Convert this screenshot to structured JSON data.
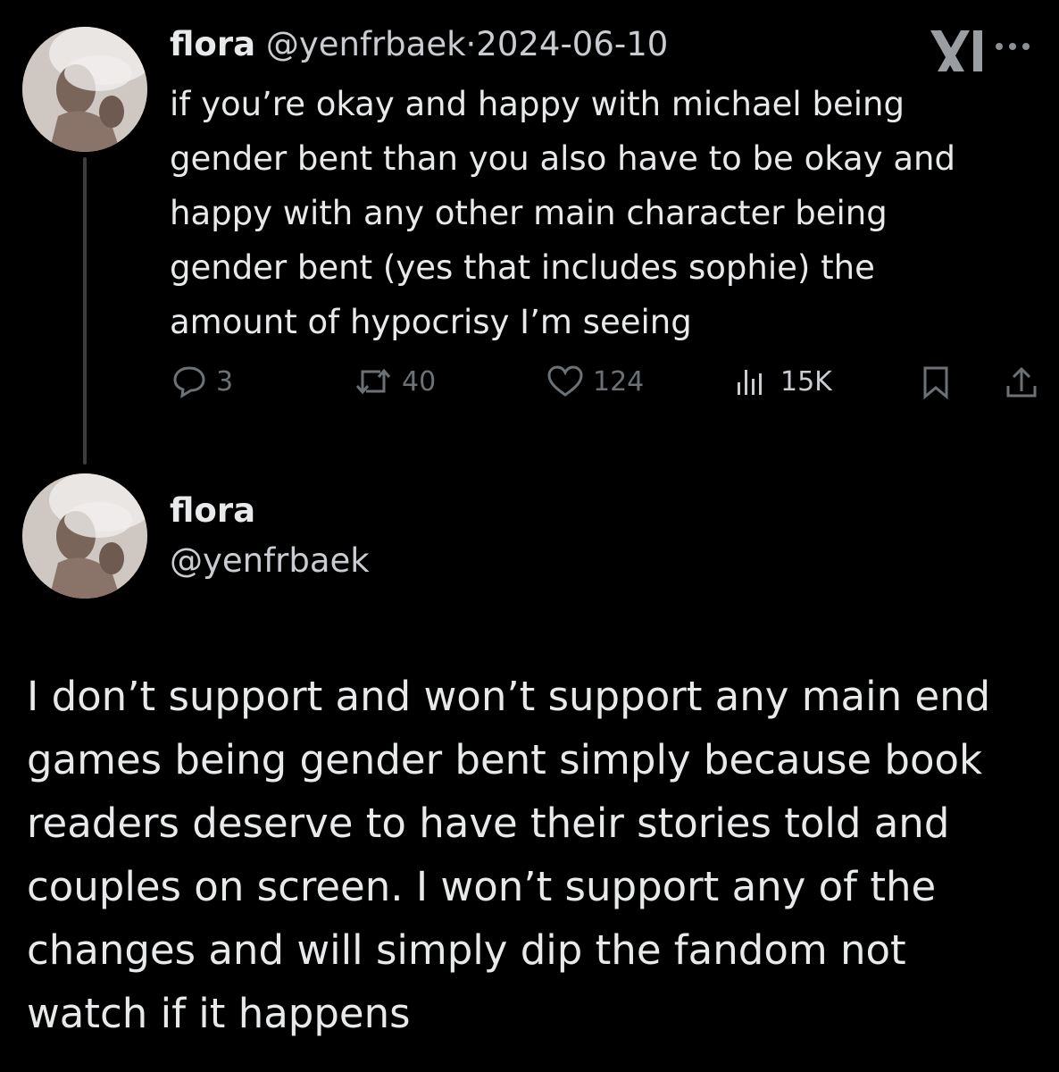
{
  "tweet1": {
    "display_name": "flora",
    "handle": "@yenfrbaek",
    "separator": "·",
    "date": "2024-06-10",
    "text": "if you’re okay and happy with michael being\ngender bent than you also have to be okay and\nhappy with any other main character being\ngender bent (yes that includes sophie) the\namount of hypocrisy I’m seeing",
    "actions": {
      "replies": "3",
      "reposts": "40",
      "likes": "124",
      "views": "15K"
    },
    "icons": [
      "x-logo-icon",
      "more-icon",
      "reply-icon",
      "repost-icon",
      "like-icon",
      "views-icon",
      "bookmark-icon",
      "share-icon"
    ]
  },
  "tweet2": {
    "display_name": "flora",
    "handle": "@yenfrbaek",
    "text": "I don’t support and won’t support any main end\ngames being gender bent simply because book\nreaders deserve to have their stories told and\ncouples on screen. I won’t support any of the\nchanges and will simply dip the fandom not\nwatch if it happens"
  },
  "colors": {
    "background": "#000000",
    "text": "#e7e9ea",
    "muted": "#6c7176",
    "thread_line": "#3a3d40"
  }
}
